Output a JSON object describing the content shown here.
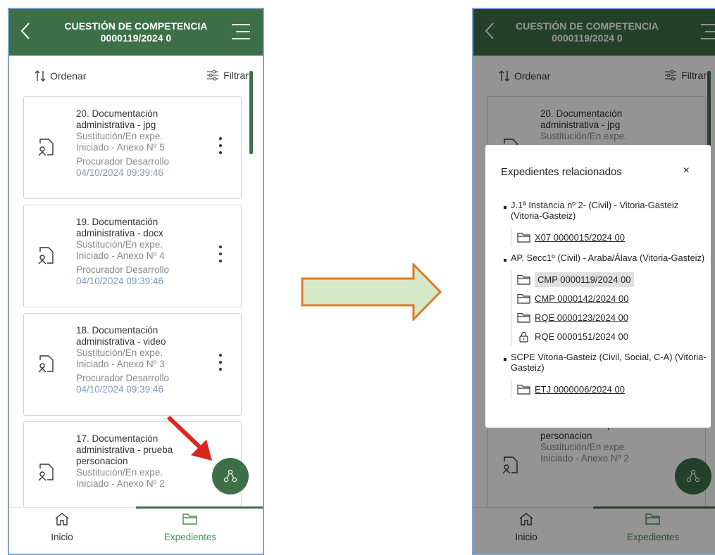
{
  "header": {
    "title_line1": "CUESTIÓN DE COMPETENCIA",
    "title_line2": "0000119/2024 0"
  },
  "toolbar": {
    "sort_label": "Ordenar",
    "filter_label": "Filtrar"
  },
  "cards": [
    {
      "title": "20. Documentación administrativa - jpg",
      "line1": "Sustitución/En expe.",
      "line2": "Iniciado - Anexo Nº 5",
      "author": "Procurador Desarrollo",
      "date": "04/10/2024 09:39:46"
    },
    {
      "title": "19. Documentación administrativa - docx",
      "line1": "Sustitución/En expe.",
      "line2": "Iniciado - Anexo Nº 4",
      "author": "Procurador Desarrollo",
      "date": "04/10/2024 09:39:46"
    },
    {
      "title": "18. Documentación administrativa - video",
      "line1": "Sustitución/En expe.",
      "line2": "Iniciado - Anexo Nº 3",
      "author": "Procurador Desarrollo",
      "date": "04/10/2024 09:39:46"
    },
    {
      "title": "17. Documentación administrativa - prueba personacion",
      "line1": "Sustitución/En expe.",
      "line2": "Iniciado - Anexo Nº 2",
      "author": "",
      "date": ""
    }
  ],
  "nav": {
    "home": "Inicio",
    "files": "Expedientes"
  },
  "modal": {
    "title": "Expedientes relacionados",
    "close": "×",
    "groups": [
      {
        "name": "J.1ª Instancia nº 2- (Civil) - Vitoria-Gasteiz (Vitoria-Gasteiz)",
        "items": [
          {
            "label": "X07 0000015/2024 00",
            "icon": "folder-icon"
          }
        ]
      },
      {
        "name": "AP. Secc1º (Civil) - Araba/Álava (Vitoria-Gasteiz)",
        "items": [
          {
            "label": "CMP 0000119/2024 00",
            "icon": "folder-icon",
            "state": "selected"
          },
          {
            "label": "CMP 0000142/2024 00",
            "icon": "folder-icon"
          },
          {
            "label": "RQE 0000123/2024 00",
            "icon": "folder-icon"
          },
          {
            "label": "RQE 0000151/2024 00",
            "icon": "lock-icon",
            "state": "locked"
          }
        ]
      },
      {
        "name": "SCPE Vitoria-Gasteiz (Civil, Social, C-A) (Vitoria-Gasteiz)",
        "items": [
          {
            "label": "ETJ 0000006/2024 00",
            "icon": "folder-icon"
          }
        ]
      }
    ]
  },
  "colors": {
    "brand_green": "#3d7047",
    "arrow_fill": "#d5e8c8",
    "arrow_stroke": "#e07a28",
    "annotation_red": "#d9261c"
  }
}
